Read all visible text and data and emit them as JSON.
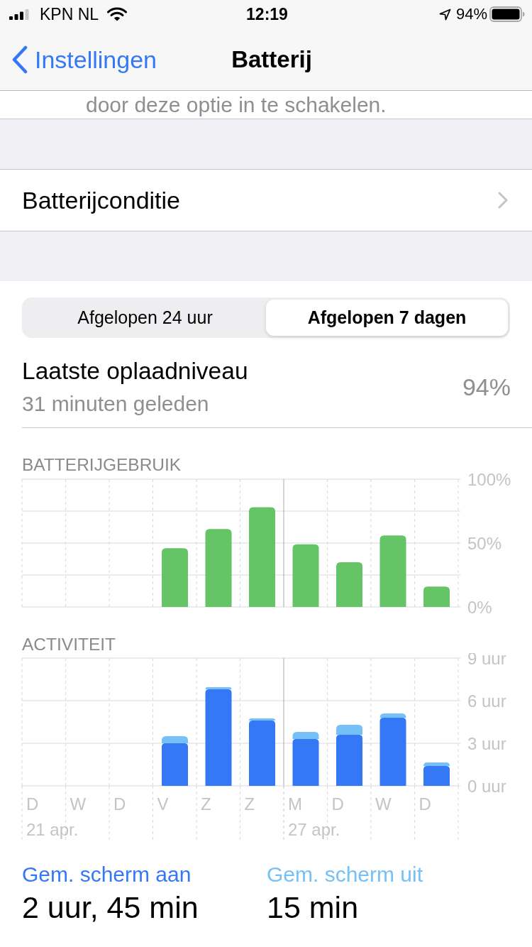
{
  "status_bar": {
    "carrier": "KPN NL",
    "time": "12:19",
    "battery": "94%"
  },
  "nav_bar": {
    "back": "Instellingen",
    "title": "Batterij"
  },
  "footnote": "door deze optie in te schakelen.",
  "rows": [
    {
      "label": "Batterijconditie"
    }
  ],
  "segments": [
    {
      "label": "Afgelopen 24 uur",
      "selected": false
    },
    {
      "label": "Afgelopen 7 dagen",
      "selected": true
    }
  ],
  "last_charge": {
    "title": "Laatste oplaadniveau",
    "subtitle": "31 minuten geleden",
    "value": "94%"
  },
  "battery_usage": {
    "title": "BATTERIJGEBRUIK",
    "chart_data": {
      "type": "bar",
      "values": [
        null,
        null,
        null,
        46,
        61,
        78,
        49,
        35,
        56,
        16
      ],
      "ylim": [
        0,
        100
      ],
      "yticks": [
        {
          "value": 0,
          "label": "0%"
        },
        {
          "value": 50,
          "label": "50%"
        },
        {
          "value": 100,
          "label": "100%"
        }
      ]
    }
  },
  "activity": {
    "title": "ACTIVITEIT",
    "chart_data": {
      "type": "bar",
      "stacked": true,
      "series": [
        {
          "color": "#3478f6",
          "values": [
            null,
            null,
            null,
            3.0,
            6.8,
            4.6,
            3.3,
            3.6,
            4.8,
            1.4
          ]
        },
        {
          "color": "#75c1f7",
          "values": [
            null,
            null,
            null,
            0.5,
            0.15,
            0.15,
            0.5,
            0.7,
            0.3,
            0.25
          ]
        }
      ],
      "ylim": [
        0,
        9
      ],
      "yticks": [
        {
          "value": 0,
          "label": "0 uur"
        },
        {
          "value": 3,
          "label": "3 uur"
        },
        {
          "value": 6,
          "label": "6 uur"
        },
        {
          "value": 9,
          "label": "9 uur"
        }
      ]
    },
    "weeks": [
      {
        "date": "21 apr.",
        "days": [
          "D",
          "W",
          "D",
          "V",
          "Z",
          "Z"
        ]
      },
      {
        "date": "27 apr.",
        "days": [
          "M",
          "D",
          "W",
          "D"
        ]
      }
    ]
  },
  "summary": [
    {
      "label": "Gem. scherm aan",
      "value": "2 uur, 45 min",
      "color": "#3478f6"
    },
    {
      "label": "Gem. scherm uit",
      "value": "15 min",
      "color": "#75c1f7"
    }
  ]
}
